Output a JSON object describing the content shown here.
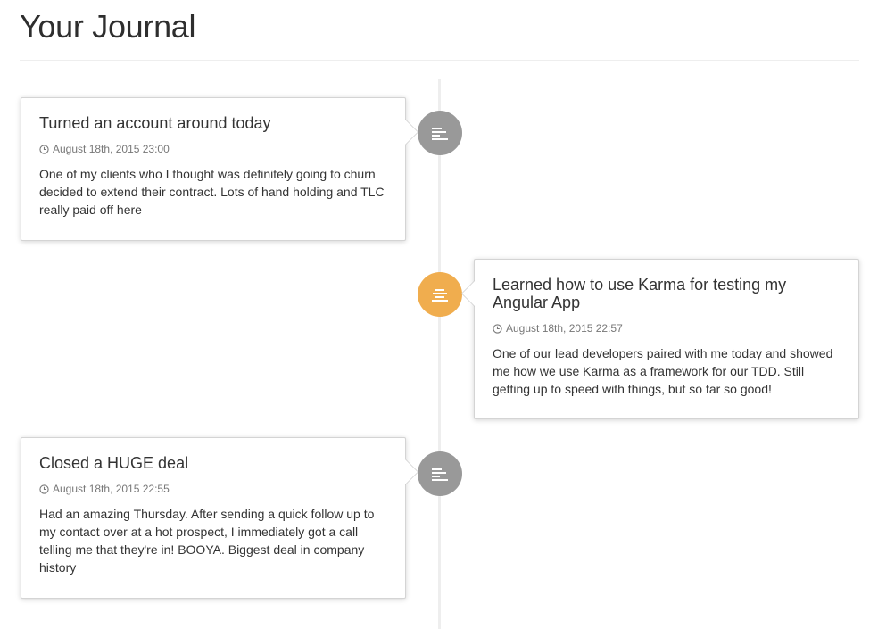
{
  "page": {
    "title": "Your Journal"
  },
  "colors": {
    "badge_default": "#999999",
    "badge_warning": "#f0ad4e",
    "timeline_line": "#eeeeee",
    "meta_text": "#777777"
  },
  "entries": [
    {
      "side": "left",
      "badge_icon": "align-left-icon",
      "badge_color": "#999999",
      "title": "Turned an account around today",
      "timestamp": "August 18th, 2015 23:00",
      "body": "One of my clients who I thought was definitely going to churn decided to extend their contract. Lots of hand holding and TLC really paid off here"
    },
    {
      "side": "right",
      "badge_icon": "align-center-icon",
      "badge_color": "#f0ad4e",
      "title": "Learned how to use Karma for testing my Angular App",
      "timestamp": "August 18th, 2015 22:57",
      "body": "One of our lead developers paired with me today and showed me how we use Karma as a framework for our TDD. Still getting up to speed with things, but so far so good!"
    },
    {
      "side": "left",
      "badge_icon": "align-left-icon",
      "badge_color": "#999999",
      "title": "Closed a HUGE deal",
      "timestamp": "August 18th, 2015 22:55",
      "body": "Had an amazing Thursday. After sending a quick follow up to my contact over at a hot prospect, I immediately got a call telling me that they're in! BOOYA. Biggest deal in company history"
    }
  ]
}
